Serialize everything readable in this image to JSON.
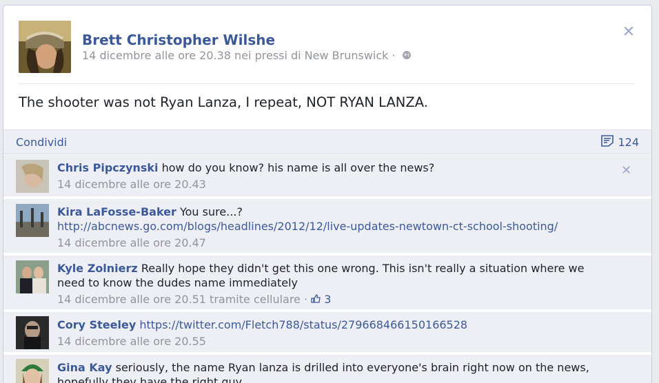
{
  "post": {
    "author": "Brett Christopher Wilshe",
    "meta": "14 dicembre alle ore 20.38 nei pressi di New Brunswick ·",
    "text": "The shooter was not Ryan Lanza, I repeat, NOT RYAN LANZA."
  },
  "share_bar": {
    "share_label": "Condividi",
    "comment_count": "124"
  },
  "comments": [
    {
      "name": "Chris Pipczynski",
      "text": "how do you know? his name is all over the news?",
      "time": "14 dicembre alle ore 20.43"
    },
    {
      "name": "Kira LaFosse-Baker",
      "text": "You sure...?",
      "link": "http://abcnews.go.com/blogs/headlines/2012/12/live-updates-newtown-ct-school-shooting/",
      "time": "14 dicembre alle ore 20.47"
    },
    {
      "name": "Kyle Zolnierz",
      "text": "Really hope they didn't get this one wrong. This isn't really a situation where we need to know the dudes name immediately",
      "time": "14 dicembre alle ore 20.51 tramite cellulare ·",
      "likes": "3"
    },
    {
      "name": "Cory Steeley",
      "link": "https://twitter.com/Fletch788/status/279668466150166528",
      "time": "14 dicembre alle ore 20.55"
    },
    {
      "name": "Gina Kay",
      "text": "seriously, the name Ryan lanza is drilled into everyone's brain right now on the news, hopefully they have the right guy."
    }
  ],
  "icons": {
    "close": "close-icon",
    "globe": "globe-icon",
    "comment": "comment-icon",
    "like": "thumbs-up-icon"
  },
  "colors": {
    "link": "#3b5998",
    "meta": "#90949c",
    "comment_bg": "#edeff4"
  }
}
